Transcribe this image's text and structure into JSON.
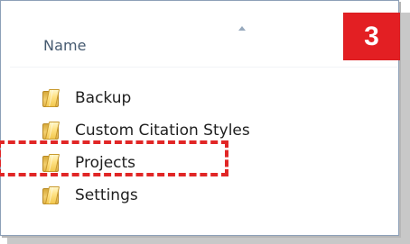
{
  "window": {
    "columns": {
      "name_label": "Name"
    }
  },
  "badge": {
    "value": "3",
    "color": "#e31f23"
  },
  "folders": [
    {
      "label": "Backup",
      "icon": "folder-icon"
    },
    {
      "label": "Custom Citation Styles",
      "icon": "folder-icon"
    },
    {
      "label": "Projects",
      "icon": "folder-icon",
      "highlighted": true
    },
    {
      "label": "Settings",
      "icon": "folder-icon"
    }
  ],
  "highlight": {
    "color": "#e12626",
    "target": "Projects"
  },
  "sort": {
    "icon": "sort-ascending-icon"
  }
}
